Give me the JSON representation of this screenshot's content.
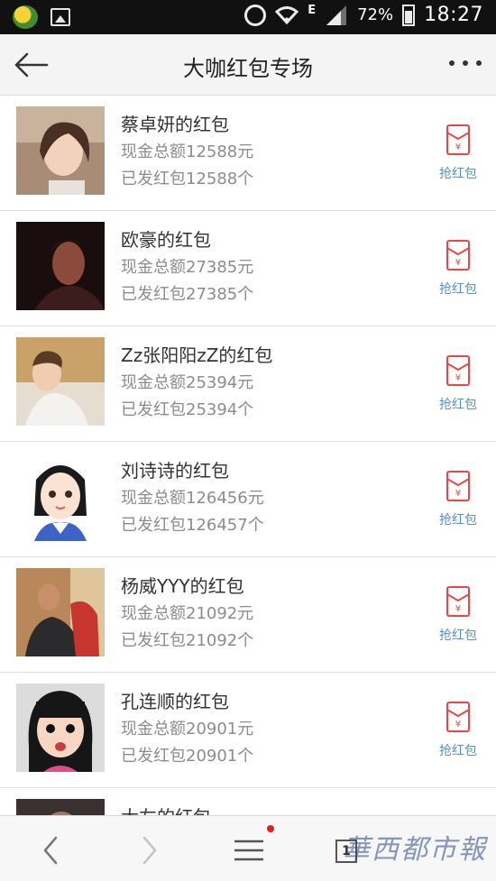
{
  "status_bar": {
    "network": "E",
    "battery": "72%",
    "time": "18:27"
  },
  "header": {
    "title": "大咖红包专场"
  },
  "list": [
    {
      "name": "蔡卓妍的红包",
      "amount": "现金总额12588元",
      "sent": "已发红包12588个",
      "action": "抢红包"
    },
    {
      "name": "欧豪的红包",
      "amount": "现金总额27385元",
      "sent": "已发红包27385个",
      "action": "抢红包"
    },
    {
      "name": "Zz张阳阳zZ的红包",
      "amount": "现金总额25394元",
      "sent": "已发红包25394个",
      "action": "抢红包"
    },
    {
      "name": "刘诗诗的红包",
      "amount": "现金总额126456元",
      "sent": "已发红包126457个",
      "action": "抢红包"
    },
    {
      "name": "杨威YYY的红包",
      "amount": "现金总额21092元",
      "sent": "已发红包21092个",
      "action": "抢红包"
    },
    {
      "name": "孔连顺的红包",
      "amount": "现金总额20901元",
      "sent": "已发红包20901个",
      "action": "抢红包"
    },
    {
      "name": "大左的红包",
      "amount": "",
      "sent": "",
      "action": ""
    }
  ],
  "bottom_nav": {
    "tab_count": "1",
    "watermark": "華西都市報"
  },
  "colors": {
    "accent_red": "#e8474a",
    "link_blue": "#5a8fc8",
    "status_bar": "#111111"
  },
  "icons": [
    "back-arrow-icon",
    "more-icon",
    "red-envelope-icon",
    "nav-back-icon",
    "nav-forward-icon",
    "menu-icon",
    "tabs-icon"
  ]
}
